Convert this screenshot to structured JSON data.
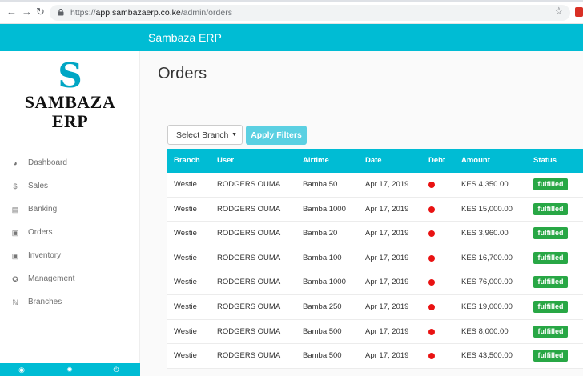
{
  "browser": {
    "url_prefix": "https://",
    "url_host": "app.sambazaerp.co.ke",
    "url_path": "/admin/orders"
  },
  "app": {
    "title": "Sambaza ERP"
  },
  "logo": {
    "mark": "S",
    "line1": "SAMBAZA",
    "line2": "ERP"
  },
  "sidebar": {
    "items": [
      {
        "label": "Dashboard",
        "icon": "dashboard-icon"
      },
      {
        "label": "Sales",
        "icon": "dollar-icon"
      },
      {
        "label": "Banking",
        "icon": "card-icon"
      },
      {
        "label": "Orders",
        "icon": "cart-icon"
      },
      {
        "label": "Inventory",
        "icon": "cart-icon"
      },
      {
        "label": "Management",
        "icon": "wrench-icon"
      },
      {
        "label": "Branches",
        "icon": "branch-icon"
      }
    ]
  },
  "footer_icons": [
    "bell-icon",
    "gear-icon",
    "power-icon"
  ],
  "page": {
    "title": "Orders"
  },
  "filters": {
    "branch_value": "Select Branch",
    "apply_label": "Apply Filters"
  },
  "table": {
    "headers": [
      "Branch",
      "User",
      "Airtime",
      "Date",
      "Debt",
      "Amount",
      "Status"
    ],
    "rows": [
      {
        "branch": "Westie",
        "user": "RODGERS OUMA",
        "airtime": "Bamba 50",
        "date": "Apr 17, 2019",
        "amount": "KES 4,350.00",
        "status": "fulfilled"
      },
      {
        "branch": "Westie",
        "user": "RODGERS OUMA",
        "airtime": "Bamba 1000",
        "date": "Apr 17, 2019",
        "amount": "KES 15,000.00",
        "status": "fulfilled"
      },
      {
        "branch": "Westie",
        "user": "RODGERS OUMA",
        "airtime": "Bamba 20",
        "date": "Apr 17, 2019",
        "amount": "KES 3,960.00",
        "status": "fulfilled"
      },
      {
        "branch": "Westie",
        "user": "RODGERS OUMA",
        "airtime": "Bamba 100",
        "date": "Apr 17, 2019",
        "amount": "KES 16,700.00",
        "status": "fulfilled"
      },
      {
        "branch": "Westie",
        "user": "RODGERS OUMA",
        "airtime": "Bamba 1000",
        "date": "Apr 17, 2019",
        "amount": "KES 76,000.00",
        "status": "fulfilled"
      },
      {
        "branch": "Westie",
        "user": "RODGERS OUMA",
        "airtime": "Bamba 250",
        "date": "Apr 17, 2019",
        "amount": "KES 19,000.00",
        "status": "fulfilled"
      },
      {
        "branch": "Westie",
        "user": "RODGERS OUMA",
        "airtime": "Bamba 500",
        "date": "Apr 17, 2019",
        "amount": "KES 8,000.00",
        "status": "fulfilled"
      },
      {
        "branch": "Westie",
        "user": "RODGERS OUMA",
        "airtime": "Bamba 500",
        "date": "Apr 17, 2019",
        "amount": "KES 43,500.00",
        "status": "fulfilled"
      }
    ]
  },
  "colors": {
    "accent": "#00bcd4",
    "debt": "#e91212",
    "status_fulfilled": "#28a745"
  }
}
